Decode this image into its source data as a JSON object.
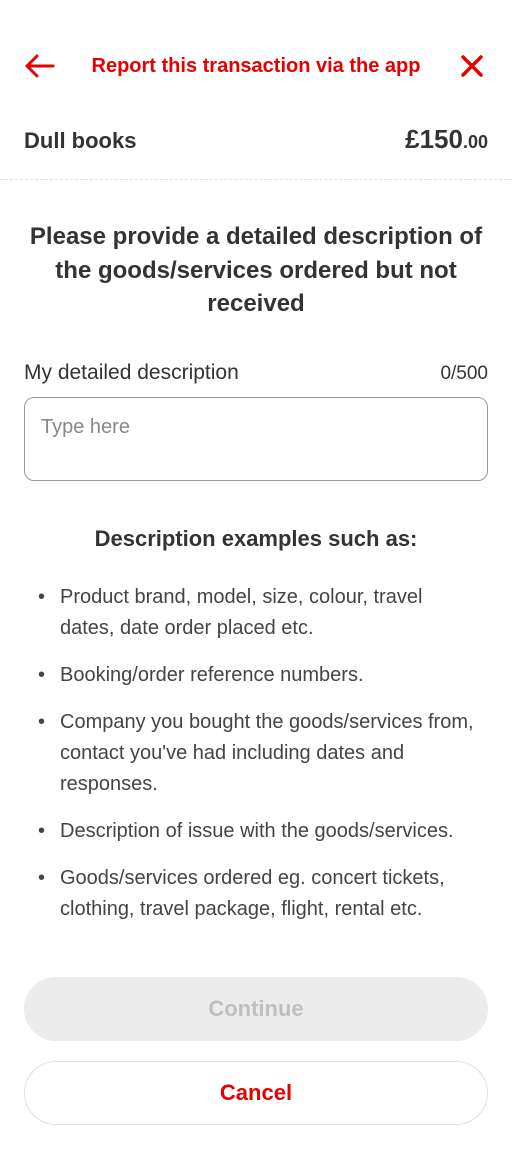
{
  "header": {
    "title": "Report this transaction via the app"
  },
  "merchant": {
    "name": "Dull books",
    "amount_currency": "£",
    "amount_whole": "150",
    "amount_decimal": ".00"
  },
  "form": {
    "question": "Please provide a detailed description of the goods/services ordered but not received",
    "field_label": "My detailed description",
    "char_count": "0/500",
    "placeholder": "Type here"
  },
  "examples": {
    "heading": "Description examples such as:",
    "items": [
      "Product brand, model, size, colour, travel dates, date order placed etc.",
      "Booking/order reference numbers.",
      "Company you bought the goods/services from, contact you've had including dates and responses.",
      "Description of issue with the goods/services.",
      "Goods/services ordered eg. concert tickets, clothing, travel package, flight, rental etc."
    ]
  },
  "buttons": {
    "continue": "Continue",
    "cancel": "Cancel"
  }
}
